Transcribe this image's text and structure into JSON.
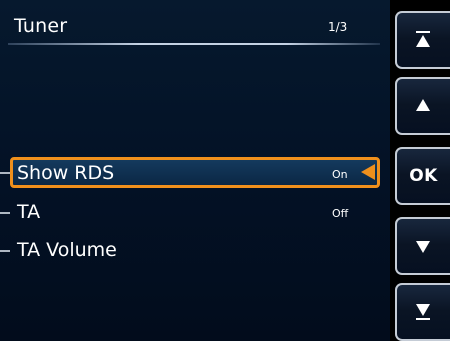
{
  "header": {
    "title": "Tuner",
    "page_indicator": "1/3"
  },
  "menu": {
    "items": [
      {
        "label": "Show RDS",
        "value": "On",
        "selected": true
      },
      {
        "label": "TA",
        "value": "Off",
        "selected": false
      },
      {
        "label": "TA Volume",
        "value": "",
        "selected": false
      }
    ]
  },
  "side_buttons": {
    "ok_label": "OK",
    "icons": [
      "page-up-icon",
      "up-arrow-icon",
      "down-arrow-icon",
      "page-down-icon"
    ]
  },
  "colors": {
    "highlight": "#f0901c",
    "background": "#031125",
    "text": "#ffffff"
  }
}
